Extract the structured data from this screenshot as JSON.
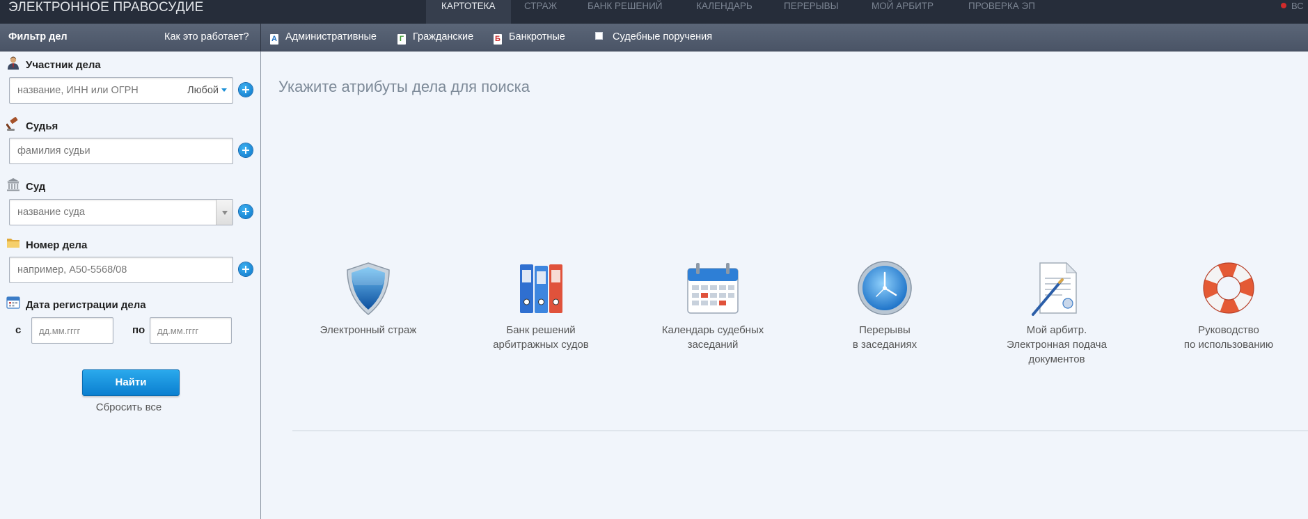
{
  "app": {
    "logo": "ЭЛЕКТРОННОЕ ПРАВОСУДИЕ"
  },
  "topnav": {
    "tabs": [
      {
        "label": "КАРТОТЕКА",
        "active": true
      },
      {
        "label": "СТРАЖ",
        "active": false
      },
      {
        "label": "БАНК РЕШЕНИЙ",
        "active": false
      },
      {
        "label": "КАЛЕНДАРЬ",
        "active": false
      },
      {
        "label": "ПЕРЕРЫВЫ",
        "active": false
      },
      {
        "label": "МОЙ АРБИТР",
        "active": false
      },
      {
        "label": "ПРОВЕРКА ЭП",
        "active": false
      }
    ],
    "right_label": "ВС"
  },
  "subbar": {
    "filter_title": "Фильтр дел",
    "how_link": "Как это работает?",
    "types": [
      {
        "letter": "А",
        "label": "Административные",
        "color": "#1f6fc0"
      },
      {
        "letter": "Г",
        "label": "Гражданские",
        "color": "#3a9a2e"
      },
      {
        "letter": "Б",
        "label": "Банкротные",
        "color": "#cc2b2b"
      }
    ],
    "court_orders_label": "Судебные поручения"
  },
  "sidebar": {
    "participant": {
      "label": "Участник дела",
      "placeholder": "название, ИНН или ОГРН",
      "role_select": "Любой"
    },
    "judge": {
      "label": "Судья",
      "placeholder": "фамилия судьи"
    },
    "court": {
      "label": "Суд",
      "placeholder": "название суда"
    },
    "case_number": {
      "label": "Номер дела",
      "placeholder": "например, А50-5568/08"
    },
    "reg_date": {
      "label": "Дата регистрации дела",
      "from_label": "с",
      "to_label": "по",
      "from_placeholder": "дд.мм.гггг",
      "to_placeholder": "дд.мм.гггг"
    },
    "find_button": "Найти",
    "reset_link": "Сбросить все"
  },
  "main": {
    "title": "Укажите атрибуты дела для поиска",
    "services": [
      {
        "icon": "shield-icon",
        "lines": [
          "Электронный страж"
        ]
      },
      {
        "icon": "binders-icon",
        "lines": [
          "Банк решений",
          "арбитражных судов"
        ]
      },
      {
        "icon": "calendar-icon",
        "lines": [
          "Календарь судебных",
          "заседаний"
        ]
      },
      {
        "icon": "clock-icon",
        "lines": [
          "Перерывы",
          "в заседаниях"
        ]
      },
      {
        "icon": "document-pen-icon",
        "lines": [
          "Мой арбитр.",
          "Электронная подача",
          "документов"
        ]
      },
      {
        "icon": "lifebuoy-icon",
        "lines": [
          "Руководство",
          "по использованию"
        ]
      }
    ]
  },
  "colors": {
    "topbar": "#262d3a",
    "subbar": "#515c6e",
    "accent": "#1a8fd6",
    "background": "#f1f5fb"
  }
}
